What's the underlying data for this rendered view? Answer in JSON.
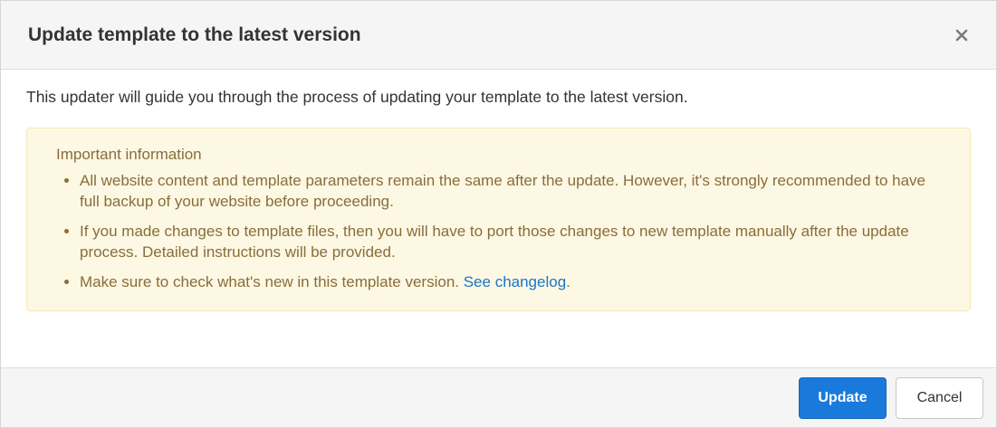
{
  "dialog": {
    "title": "Update template to the latest version",
    "close_icon": "close-icon",
    "intro": "This updater will guide you through the process of updating your template to the latest version.",
    "info": {
      "title": "Important information",
      "items": [
        "All website content and template parameters remain the same after the update. However, it's strongly recommended to have full backup of your website before proceeding.",
        "If you made changes to template files, then you will have to port those changes to new template manually after the update process. Detailed instructions will be provided.",
        "Make sure to check what's new in this template version. "
      ],
      "link_label": "See changelog",
      "link_suffix": "."
    },
    "buttons": {
      "update": "Update",
      "cancel": "Cancel"
    }
  },
  "colors": {
    "primary": "#1a7adb",
    "warning_bg": "#fcf8e3",
    "warning_text": "#8a6d3b",
    "link": "#1a75c7"
  }
}
